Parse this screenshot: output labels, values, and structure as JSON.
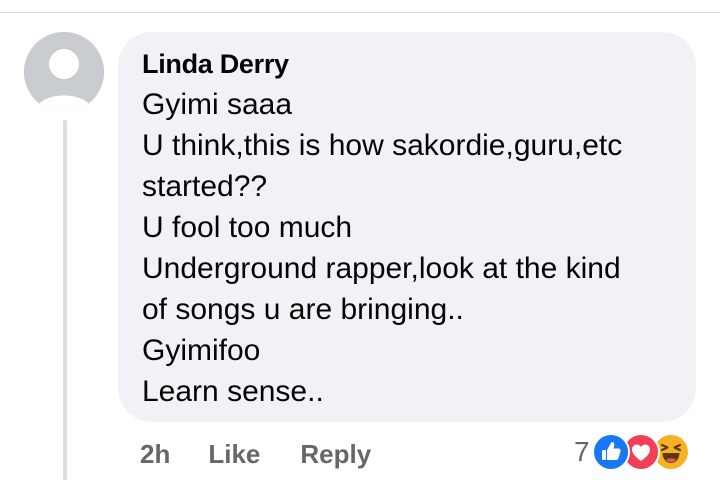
{
  "comment": {
    "author": "Linda Derry",
    "lines": [
      "Gyimi saaa",
      "U think,this  is how sakordie,guru,etc",
      "started??",
      "U fool too much",
      "Underground rapper,look at the kind",
      "of songs u are bringing..",
      "Gyimifoo",
      "Learn sense.."
    ]
  },
  "actions": {
    "time": "2h",
    "like_label": "Like",
    "reply_label": "Reply"
  },
  "reactions": {
    "count": "7",
    "icons": [
      "like-icon",
      "love-icon",
      "haha-icon"
    ],
    "colors": {
      "like": "#1877f2",
      "love": "#f33e58",
      "haha": "#f7b125"
    }
  },
  "colors": {
    "bubble": "#f0f2f5",
    "text": "#050505",
    "secondary": "#65676b"
  }
}
